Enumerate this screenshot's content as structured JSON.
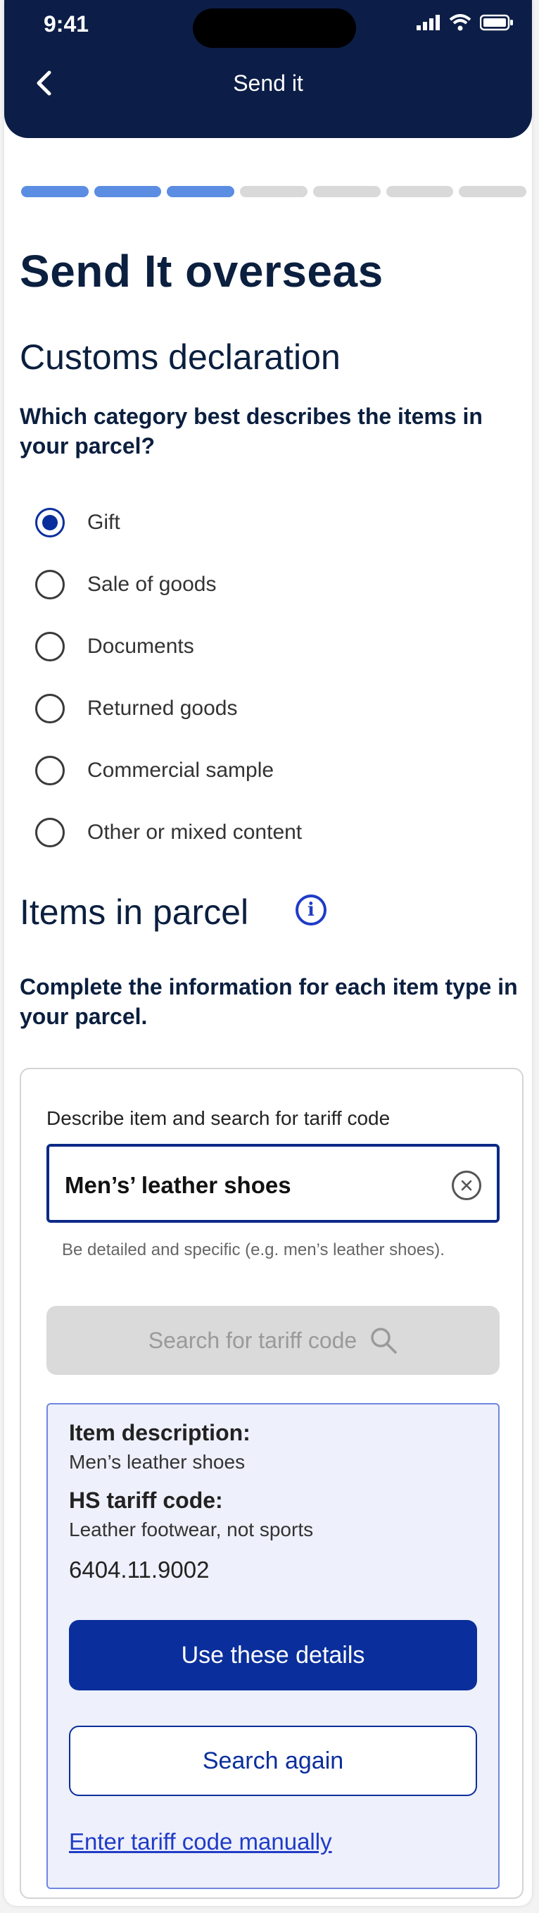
{
  "status_bar": {
    "time": "9:41"
  },
  "header": {
    "title": "Send it"
  },
  "progress": {
    "total_steps": 7,
    "completed_steps": 3
  },
  "page": {
    "title": "Send It overseas",
    "section1_title": "Customs declaration",
    "question": "Which category best describes the items in your parcel?",
    "categories": [
      {
        "label": "Gift",
        "selected": true
      },
      {
        "label": "Sale of goods",
        "selected": false
      },
      {
        "label": "Documents",
        "selected": false
      },
      {
        "label": "Returned goods",
        "selected": false
      },
      {
        "label": "Commercial sample",
        "selected": false
      },
      {
        "label": "Other or mixed content",
        "selected": false
      }
    ],
    "section2_title": "Items in parcel",
    "instructions": "Complete the information for each item type in your parcel."
  },
  "item_card": {
    "field_label": "Describe item and search for tariff code",
    "input_value": "Men’s’ leather shoes",
    "hint": "Be detailed and specific (e.g. men’s leather shoes).",
    "search_button": "Search for tariff code",
    "result": {
      "description_label": "Item description:",
      "description_value": "Men’s leather shoes",
      "tariff_label": "HS tariff code:",
      "tariff_desc": "Leather footwear, not sports",
      "tariff_code": "6404.11.9002",
      "use_button": "Use these details",
      "search_again_button": "Search again",
      "manual_link": "Enter tariff code manually"
    }
  },
  "colors": {
    "header_bg": "#0c1e47",
    "primary": "#0a2f9c",
    "progress_active": "#5b8de2",
    "progress_inactive": "#d9d9d9",
    "result_bg": "#eef0fb"
  }
}
